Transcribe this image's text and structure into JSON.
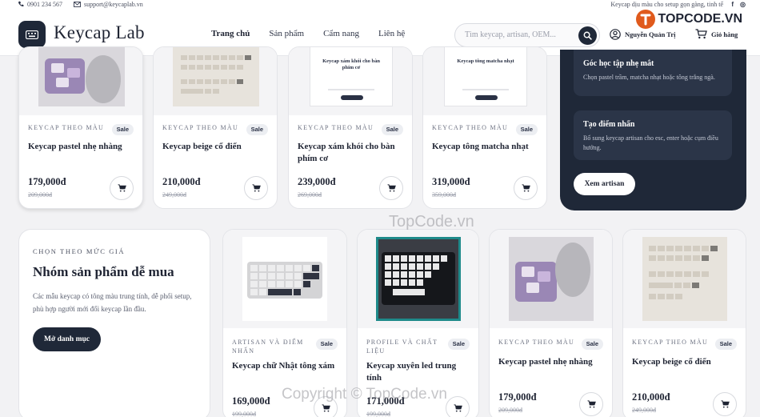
{
  "topbar": {
    "phone": "0901 234 567",
    "email": "support@keycaplab.vn",
    "promo": "Keycap dịu màu cho setup gọn gàng, tinh tế"
  },
  "header": {
    "brand": "Keycap Lab",
    "nav": [
      "Trang chủ",
      "Sản phẩm",
      "Cẩm nang",
      "Liên hệ"
    ],
    "search_placeholder": "Tìm keycap, artisan, OEM...",
    "user": "Nguyễn Quản Trị",
    "cart": "Giỏ hàng"
  },
  "products_row1": [
    {
      "category": "KEYCAP THEO MÀU",
      "badge": "Sale",
      "name": "Keycap pastel nhẹ nhàng",
      "price": "179,000đ",
      "old_price": "209,000đ",
      "image": "purple-keycap-photo"
    },
    {
      "category": "KEYCAP THEO MÀU",
      "badge": "Sale",
      "name": "Keycap beige cổ điển",
      "price": "210,000đ",
      "old_price": "249,000đ",
      "image": "beige-keycap-set"
    },
    {
      "category": "KEYCAP THEO MÀU",
      "badge": "Sale",
      "name": "Keycap xám khói cho bàn phím cơ",
      "price": "239,000đ",
      "old_price": "269,000đ",
      "image": "placeholder-card",
      "image_text": "Keycap xám khói cho bàn phím cơ"
    },
    {
      "category": "KEYCAP THEO MÀU",
      "badge": "Sale",
      "name": "Keycap tông matcha nhạt",
      "price": "319,000đ",
      "old_price": "359,000đ",
      "image": "placeholder-card",
      "image_text": "Keycap tông matcha nhạt"
    }
  ],
  "sidebar_panel": {
    "tips": [
      {
        "title": "Góc học tập nhẹ mắt",
        "desc": "Chọn pastel trầm, matcha nhạt hoặc tông trắng ngà."
      },
      {
        "title": "Tạo điểm nhấn",
        "desc": "Bổ sung keycap artisan cho esc, enter hoặc cụm điều hướng."
      }
    ],
    "cta": "Xem artisan"
  },
  "promo": {
    "eyebrow": "CHỌN THEO MỨC GIÁ",
    "title": "Nhóm sản phẩm dễ mua",
    "desc": "Các mẫu keycap có tông màu trung tính, dễ phối setup, phù hợp người mới đổi keycap lần đầu.",
    "button": "Mở danh mục"
  },
  "products_row2": [
    {
      "category": "ARTISAN VÀ ĐIỂM NHẤN",
      "badge": "Sale",
      "name": "Keycap chữ Nhật tông xám",
      "price": "169,000đ",
      "old_price": "199,000đ",
      "image": "white-keyboard"
    },
    {
      "category": "PROFILE VÀ CHẤT LIỆU",
      "badge": "Sale",
      "name": "Keycap xuyên led trung tính",
      "price": "171,000đ",
      "old_price": "199,000đ",
      "image": "dark-keyboard"
    },
    {
      "category": "KEYCAP THEO MÀU",
      "badge": "Sale",
      "name": "Keycap pastel nhẹ nhàng",
      "price": "179,000đ",
      "old_price": "209,000đ",
      "image": "purple-keycap-photo"
    },
    {
      "category": "KEYCAP THEO MÀU",
      "badge": "Sale",
      "name": "Keycap beige cổ điển",
      "price": "210,000đ",
      "old_price": "249,000đ",
      "image": "beige-keycap-set"
    }
  ],
  "watermark": {
    "mid": "TopCode.vn",
    "bottom": "Copyright © TopCode.vn",
    "logo": "TOPCODE.VN"
  },
  "colors": {
    "primary": "#1f2838",
    "panel_tile": "#2b3548",
    "background": "#f2f2f4",
    "logo_accent": "#e05a1c"
  }
}
